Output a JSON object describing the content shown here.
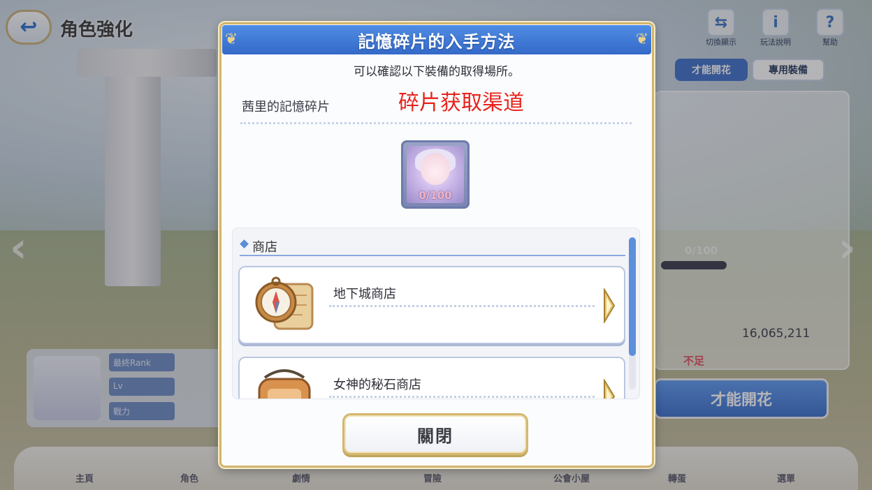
{
  "background": {
    "page_title": "角色強化",
    "top_icons": [
      {
        "icon": "swap-display-icon",
        "label": "切換顯示"
      },
      {
        "icon": "info-icon",
        "label": "玩法說明"
      },
      {
        "icon": "help-icon",
        "label": "幫助"
      }
    ],
    "tabs": [
      "才能開花",
      "專用裝備"
    ],
    "progress_text": "0/100",
    "mana_value": "16,065,211",
    "insufficient_text": "不足",
    "bloom_button": "才能開花",
    "stat_labels": [
      "最終Rank",
      "Lv",
      "戰力"
    ],
    "nav_items": [
      "主頁",
      "角色",
      "劇情",
      "冒險",
      "公會小屋",
      "轉蛋",
      "選單"
    ]
  },
  "dialog": {
    "title": "記憶碎片的入手方法",
    "subtitle": "可以確認以下裝備的取得場所。",
    "item_name": "茜里的記憶碎片",
    "annotation": "碎片获取渠道",
    "shard_count": "0/100",
    "category": "商店",
    "sources": [
      {
        "name": "地下城商店",
        "icon": "compass-map-icon"
      },
      {
        "name": "女神的秘石商店",
        "icon": "open-sign-icon"
      }
    ],
    "close_label": "關閉"
  }
}
